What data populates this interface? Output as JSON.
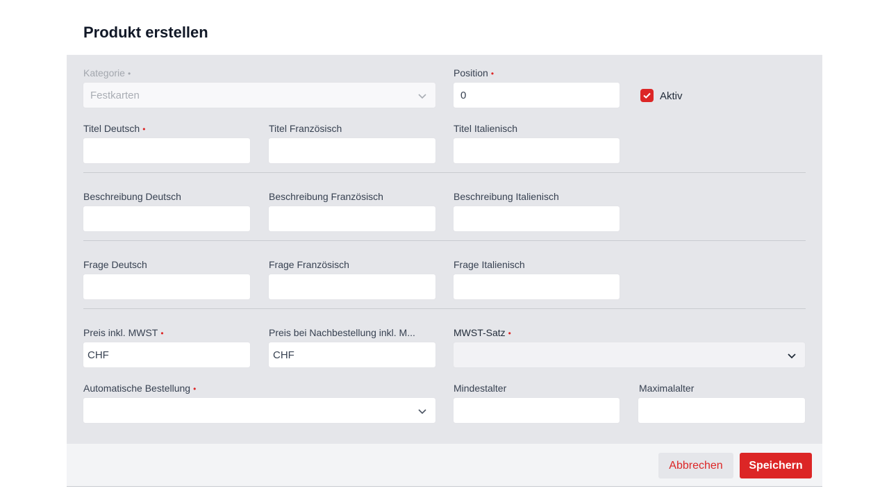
{
  "dialog": {
    "title": "Produkt erstellen"
  },
  "form": {
    "kategorie": {
      "label": "Kategorie",
      "value": "Festkarten"
    },
    "position": {
      "label": "Position",
      "value": "0"
    },
    "aktiv": {
      "label": "Aktiv",
      "checked": true
    },
    "titel_de": {
      "label": "Titel Deutsch",
      "value": ""
    },
    "titel_fr": {
      "label": "Titel Französisch",
      "value": ""
    },
    "titel_it": {
      "label": "Titel Italienisch",
      "value": ""
    },
    "beschreibung_de": {
      "label": "Beschreibung Deutsch",
      "value": ""
    },
    "beschreibung_fr": {
      "label": "Beschreibung Französisch",
      "value": ""
    },
    "beschreibung_it": {
      "label": "Beschreibung Italienisch",
      "value": ""
    },
    "frage_de": {
      "label": "Frage Deutsch",
      "value": ""
    },
    "frage_fr": {
      "label": "Frage Französisch",
      "value": ""
    },
    "frage_it": {
      "label": "Frage Italienisch",
      "value": ""
    },
    "preis": {
      "label": "Preis inkl. MWST",
      "value": "CHF"
    },
    "preis_nachbestellung": {
      "label": "Preis bei Nachbestellung inkl. M...",
      "value": "CHF"
    },
    "mwst_satz": {
      "label": "MWST-Satz",
      "value": ""
    },
    "automatische_bestellung": {
      "label": "Automatische Bestellung",
      "value": ""
    },
    "mindestalter": {
      "label": "Mindestalter",
      "value": ""
    },
    "maximalalter": {
      "label": "Maximalalter",
      "value": ""
    },
    "required_marker": "•"
  },
  "footer": {
    "cancel_label": "Abbrechen",
    "save_label": "Speichern"
  },
  "colors": {
    "accent": "#dc2626",
    "panel": "#e5e6ea"
  },
  "icons": {
    "select": "chevron-down-icon",
    "checkbox": "check-icon"
  }
}
